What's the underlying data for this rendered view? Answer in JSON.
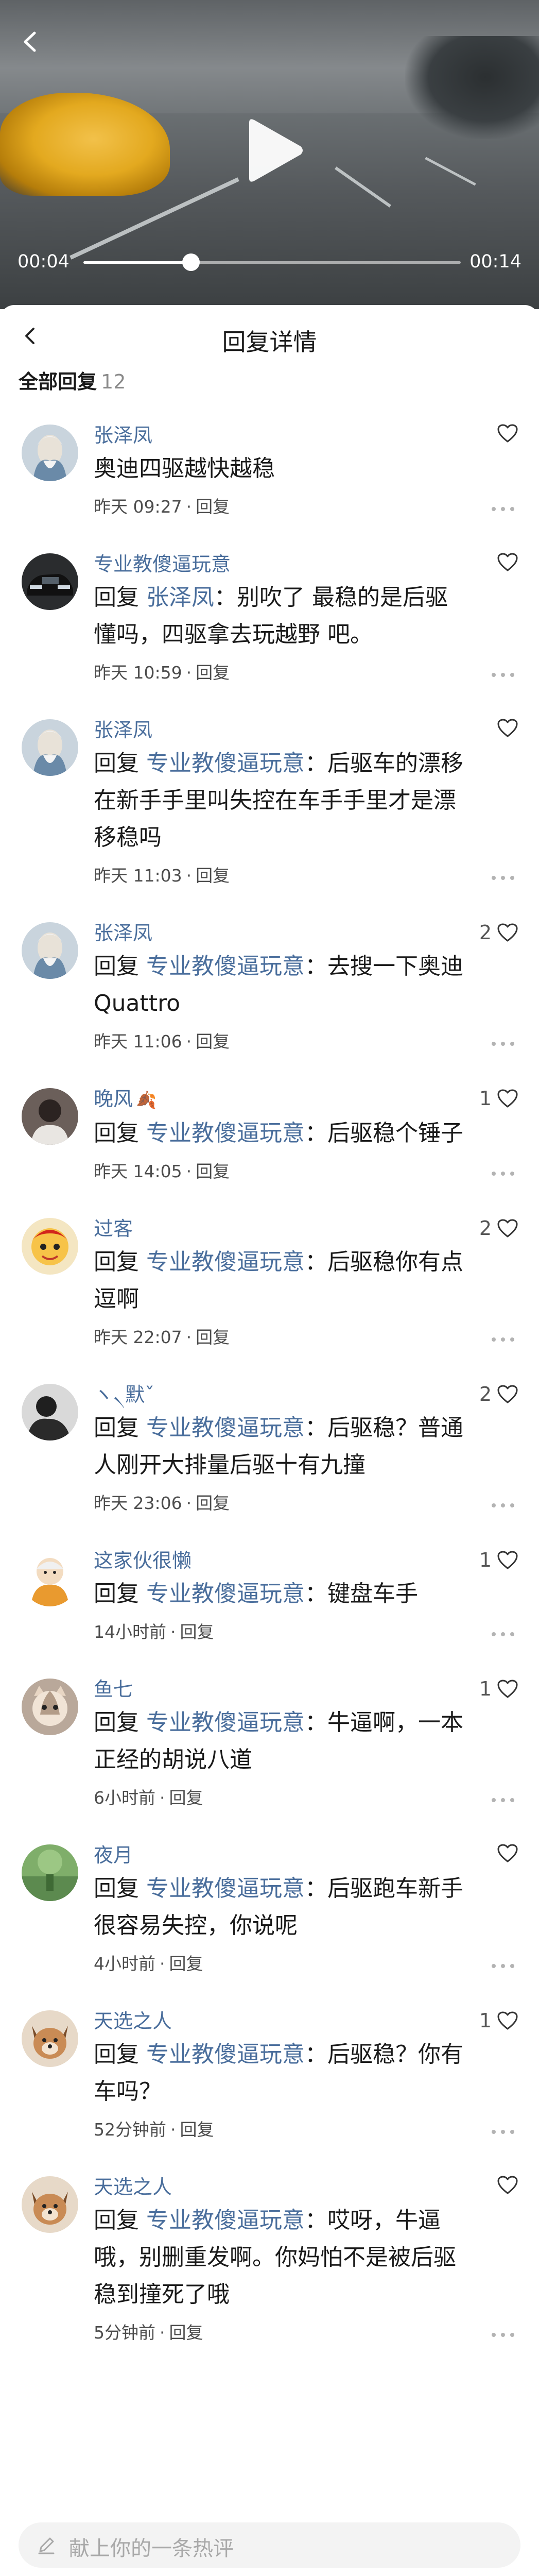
{
  "video": {
    "current_time": "00:04",
    "total_time": "00:14",
    "progress": 0.285
  },
  "sheet": {
    "title": "回复详情",
    "all_replies_label": "全部回复",
    "reply_count": "12"
  },
  "comments": [
    {
      "user": "张泽凤",
      "emoji": "",
      "text": "奥迪四驱越快越稳",
      "prefix": "",
      "mention": "",
      "suffix": "",
      "time": "昨天 09:27",
      "reply_label": "回复",
      "likes": "",
      "avatar_style": "elder"
    },
    {
      "user": "专业教傻逼玩意",
      "emoji": "",
      "text": "",
      "prefix": "回复 ",
      "mention": "张泽凤",
      "suffix": "：别吹了 最稳的是后驱懂吗，四驱拿去玩越野 吧。",
      "time": "昨天 10:59",
      "reply_label": "回复",
      "likes": "",
      "avatar_style": "car"
    },
    {
      "user": "张泽凤",
      "emoji": "",
      "text": "",
      "prefix": "回复 ",
      "mention": "专业教傻逼玩意",
      "suffix": "：后驱车的漂移在新手手里叫失控在车手手里才是漂移稳吗",
      "time": "昨天 11:03",
      "reply_label": "回复",
      "likes": "",
      "avatar_style": "elder"
    },
    {
      "user": "张泽凤",
      "emoji": "",
      "text": "",
      "prefix": "回复 ",
      "mention": "专业教傻逼玩意",
      "suffix": "：去搜一下奥迪Quattro",
      "time": "昨天 11:06",
      "reply_label": "回复",
      "likes": "2",
      "avatar_style": "elder"
    },
    {
      "user": "晚风",
      "emoji": "🍂",
      "text": "",
      "prefix": "回复 ",
      "mention": "专业教傻逼玩意",
      "suffix": "：后驱稳个锤子",
      "time": "昨天 14:05",
      "reply_label": "回复",
      "likes": "1",
      "avatar_style": "dark"
    },
    {
      "user": "过客",
      "emoji": "",
      "text": "",
      "prefix": "回复 ",
      "mention": "专业教傻逼玩意",
      "suffix": "：后驱稳你有点逗啊",
      "time": "昨天 22:07",
      "reply_label": "回复",
      "likes": "2",
      "avatar_style": "cartoon"
    },
    {
      "user": "ヽ৲默ˇ",
      "emoji": "",
      "text": "",
      "prefix": "回复 ",
      "mention": "专业教傻逼玩意",
      "suffix": "：后驱稳？普通人刚开大排量后驱十有九撞",
      "time": "昨天 23:06",
      "reply_label": "回复",
      "likes": "2",
      "avatar_style": "mono"
    },
    {
      "user": "这家伙很懒",
      "emoji": "",
      "text": "",
      "prefix": "回复 ",
      "mention": "专业教傻逼玩意",
      "suffix": "：键盘车手",
      "time": "14小时前",
      "reply_label": "回复",
      "likes": "1",
      "avatar_style": "monk"
    },
    {
      "user": "鱼七",
      "emoji": "",
      "text": "",
      "prefix": "回复 ",
      "mention": "专业教傻逼玩意",
      "suffix": "：牛逼啊，一本正经的胡说八道",
      "time": "6小时前",
      "reply_label": "回复",
      "likes": "1",
      "avatar_style": "cat"
    },
    {
      "user": "夜月",
      "emoji": "",
      "text": "",
      "prefix": "回复 ",
      "mention": "专业教傻逼玩意",
      "suffix": "：后驱跑车新手很容易失控，你说呢",
      "time": "4小时前",
      "reply_label": "回复",
      "likes": "",
      "avatar_style": "green"
    },
    {
      "user": "天选之人",
      "emoji": "",
      "text": "",
      "prefix": "回复 ",
      "mention": "专业教傻逼玩意",
      "suffix": "：后驱稳？你有车吗？",
      "time": "52分钟前",
      "reply_label": "回复",
      "likes": "1",
      "avatar_style": "dog"
    },
    {
      "user": "天选之人",
      "emoji": "",
      "text": "",
      "prefix": "回复 ",
      "mention": "专业教傻逼玩意",
      "suffix": "：哎呀，牛逼哦，别删重发啊。你妈怕不是被后驱稳到撞死了哦",
      "time": "5分钟前",
      "reply_label": "回复",
      "likes": "",
      "avatar_style": "dog"
    }
  ],
  "input": {
    "placeholder": "献上你的一条热评"
  },
  "colors": {
    "link": "#4a6e9c",
    "meta": "#4d4d4d"
  }
}
